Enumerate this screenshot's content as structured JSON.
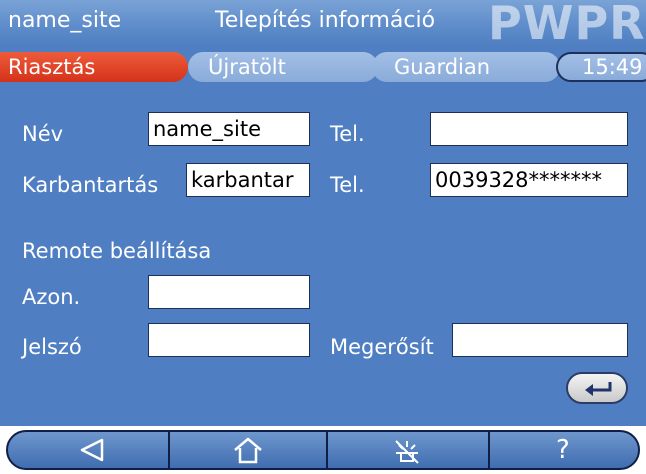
{
  "header": {
    "site_name": "name_site",
    "title": "Telepítés információ",
    "brand": "PWPRO"
  },
  "tabs": {
    "alarm": "Riasztás",
    "reload": "Újratölt",
    "guardian": "Guardian",
    "clock": "15:49"
  },
  "form": {
    "name_label": "Név",
    "name_value": "name_site",
    "phone1_label": "Tel.",
    "phone1_value": "",
    "maintenance_label": "Karbantartás",
    "maintenance_value": "karbantar",
    "phone2_label": "Tel.",
    "phone2_value": "0039328*******",
    "remote_heading": "Remote beállítása",
    "id_label": "Azon.",
    "id_value": "",
    "password_label": "Jelszó",
    "password_value": "",
    "confirm_label": "Megerősít",
    "confirm_value": ""
  },
  "nav": {
    "help": "?"
  },
  "icons": [
    "enter-icon",
    "back-arrow-icon",
    "home-icon",
    "alarm-off-icon"
  ],
  "colors": {
    "background": "#4f7fc2",
    "active_tab": "#d4321a",
    "inactive_tab": "#8aabd9",
    "field_bg": "#ffffff"
  }
}
